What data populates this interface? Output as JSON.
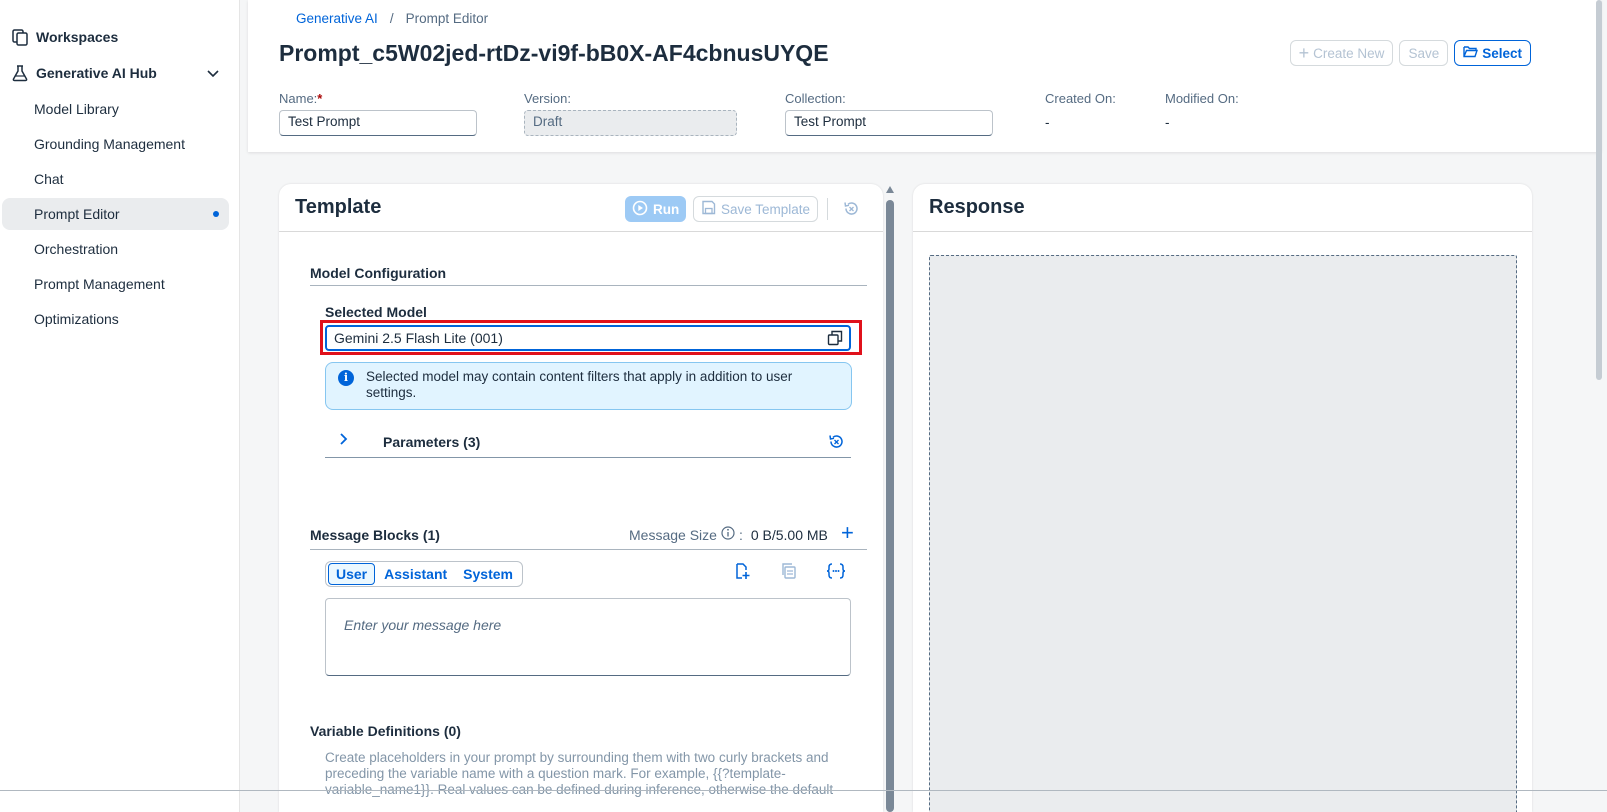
{
  "sidebar": {
    "workspaces_label": "Workspaces",
    "genai_hub_label": "Generative AI Hub",
    "items": [
      {
        "label": "Model Library"
      },
      {
        "label": "Grounding Management"
      },
      {
        "label": "Chat"
      },
      {
        "label": "Prompt Editor",
        "active": true
      },
      {
        "label": "Orchestration"
      },
      {
        "label": "Prompt Management"
      },
      {
        "label": "Optimizations"
      }
    ]
  },
  "breadcrumb": {
    "root": "Generative AI",
    "separator": "/",
    "current": "Prompt Editor"
  },
  "header": {
    "title": "Prompt_c5W02jed-rtDz-vi9f-bB0X-AF4cbnusUYQE",
    "create_new_label": "Create New",
    "save_label": "Save",
    "select_label": "Select"
  },
  "fields": {
    "name_label": "Name:",
    "name_required_mark": "*",
    "name_value": "Test Prompt",
    "version_label": "Version:",
    "version_value": "Draft",
    "collection_label": "Collection:",
    "collection_value": "Test Prompt",
    "created_on_label": "Created On:",
    "created_on_value": "-",
    "modified_on_label": "Modified On:",
    "modified_on_value": "-"
  },
  "template": {
    "title": "Template",
    "run_label": "Run",
    "save_template_label": "Save Template",
    "model_config_title": "Model Configuration",
    "selected_model_label": "Selected Model",
    "selected_model_value": "Gemini 2.5 Flash Lite (001)",
    "info_text": "Selected model may contain content filters that apply in addition to user settings.",
    "parameters_label": "Parameters (3)",
    "message_blocks_title": "Message Blocks (1)",
    "message_size_label": "Message Size",
    "message_size_sep": ":",
    "message_size_value": "0 B/5.00 MB",
    "roles": [
      "User",
      "Assistant",
      "System"
    ],
    "message_placeholder": "Enter your message here",
    "variable_defs_title": "Variable Definitions (0)",
    "variable_defs_desc": "Create placeholders in your prompt by surrounding them with two curly brackets and preceding the variable name with a question mark. For example, {{?template-variable_name1}}. Real values can be defined during inference, otherwise the default"
  },
  "response": {
    "title": "Response"
  },
  "colors": {
    "accent": "#0064d9",
    "highlight": "#e0111b",
    "info_bg": "#e1f4ff"
  }
}
